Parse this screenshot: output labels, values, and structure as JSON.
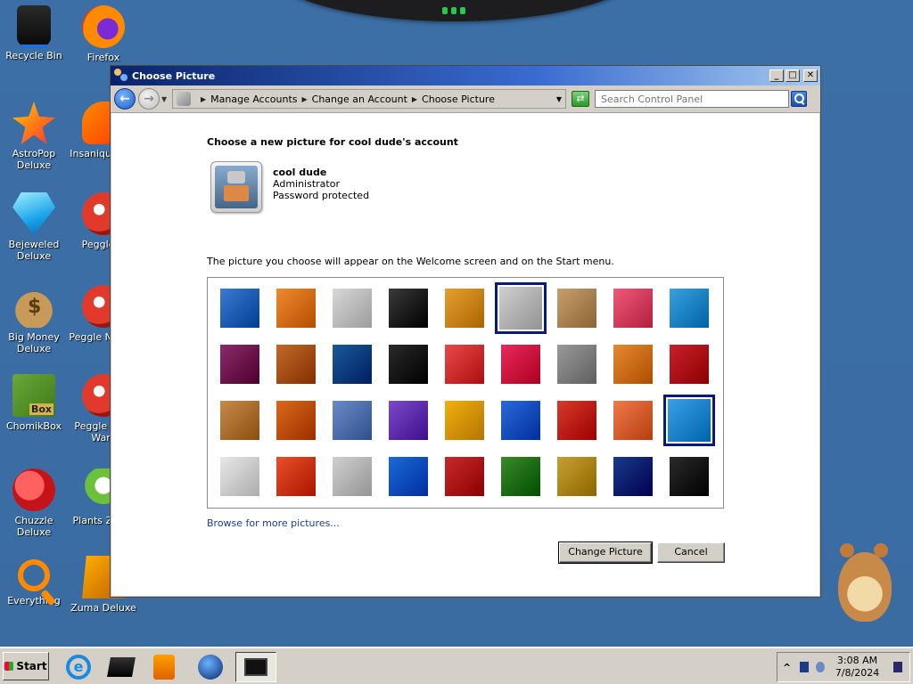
{
  "desktop": {
    "icons": [
      {
        "label": "Recycle Bin"
      },
      {
        "label": "Firefox"
      },
      {
        "label": "AstroPop Deluxe"
      },
      {
        "label": "Insaniquarium Deluxe",
        "visible": "Insaniqu Delu"
      },
      {
        "label": "Bejeweled Deluxe"
      },
      {
        "label": "Peggle Deluxe",
        "visible": "Peggle D"
      },
      {
        "label": "Big Money Deluxe"
      },
      {
        "label": "Peggle Nights Deluxe",
        "visible": "Peggle N Delu"
      },
      {
        "label": "ChomikBox"
      },
      {
        "label": "Peggle World of Warcraft",
        "visible": "Peggle W of Warc"
      },
      {
        "label": "Chuzzle Deluxe"
      },
      {
        "label": "Plants vs. Zombies",
        "visible": "Plants Zomb"
      },
      {
        "label": "Everything"
      },
      {
        "label": "Zuma Deluxe"
      }
    ],
    "chomik_badge": "Box",
    "money_symbol": "$"
  },
  "window": {
    "title": "Choose Picture",
    "controls": {
      "minimize": "_",
      "maximize": "□",
      "close": "✕"
    },
    "breadcrumbs": [
      "Manage Accounts",
      "Change an Account",
      "Choose Picture"
    ],
    "search_placeholder": "Search Control Panel",
    "heading": "Choose a new picture for cool dude's account",
    "account": {
      "name": "cool dude",
      "role": "Administrator",
      "security": "Password protected"
    },
    "description": "The picture you choose will appear on the Welcome screen and on the Start menu.",
    "browse_link": "Browse for more pictures...",
    "buttons": {
      "change": "Change Picture",
      "cancel": "Cancel"
    },
    "pictures": [
      {
        "name": "roller-coaster",
        "color": "#3a7ad0"
      },
      {
        "name": "starfish",
        "color": "#f08a30"
      },
      {
        "name": "robot-bunny",
        "color": "#d8d8d8"
      },
      {
        "name": "turntable",
        "color": "#3a3a3a"
      },
      {
        "name": "lucky-cat",
        "color": "#e6a030"
      },
      {
        "name": "satellite-dish",
        "color": "#cfcfcf"
      },
      {
        "name": "kitten",
        "color": "#c8a070"
      },
      {
        "name": "flower-pink",
        "color": "#f05a7a"
      },
      {
        "name": "ferris-wheel",
        "color": "#3aa0e0"
      },
      {
        "name": "bowling-ball",
        "color": "#8a2a6a"
      },
      {
        "name": "fabric-stripes",
        "color": "#c06a2a"
      },
      {
        "name": "ginkgo-leaf",
        "color": "#1a5a9a"
      },
      {
        "name": "border-collie",
        "color": "#2a2a2a"
      },
      {
        "name": "crayons",
        "color": "#e84a4a"
      },
      {
        "name": "paper-star",
        "color": "#e82a5a"
      },
      {
        "name": "jacks",
        "color": "#9a9a9a"
      },
      {
        "name": "stairs",
        "color": "#e88a30"
      },
      {
        "name": "origami-crane",
        "color": "#c8202a"
      },
      {
        "name": "guitar",
        "color": "#c88a4a"
      },
      {
        "name": "pomeranian",
        "color": "#d86a1a"
      },
      {
        "name": "toy-robot",
        "color": "#6a8ac8"
      },
      {
        "name": "silk-scarf",
        "color": "#7a4ac8"
      },
      {
        "name": "sunflower",
        "color": "#f0b010"
      },
      {
        "name": "tropical-fish",
        "color": "#2a6ad8"
      },
      {
        "name": "hot-air-balloon",
        "color": "#d83a2a"
      },
      {
        "name": "matryoshka",
        "color": "#f07a4a"
      },
      {
        "name": "sailboat",
        "color": "#3aa0e8"
      },
      {
        "name": "soccer-ball",
        "color": "#e8e8e8"
      },
      {
        "name": "colorful-stripes",
        "color": "#e8502a"
      },
      {
        "name": "marbles",
        "color": "#d0d0d0"
      },
      {
        "name": "green-window",
        "color": "#1a6ad8"
      },
      {
        "name": "woven-pattern",
        "color": "#c82a2a"
      },
      {
        "name": "butterfly",
        "color": "#3a8a2a"
      },
      {
        "name": "wicker-spiral",
        "color": "#c8a030"
      },
      {
        "name": "lighthouse",
        "color": "#1a3a8a"
      },
      {
        "name": "chess-board",
        "color": "#2a2a2a"
      }
    ],
    "selected_picture": "sailboat",
    "hover_picture": "satellite-dish"
  },
  "taskbar": {
    "start_label": "Start",
    "apps": [
      "internet-explorer",
      "virtual-box",
      "media-player",
      "globe",
      "display-settings"
    ],
    "tray_chevron": "^",
    "time": "3:08 AM",
    "date": "7/8/2024"
  }
}
